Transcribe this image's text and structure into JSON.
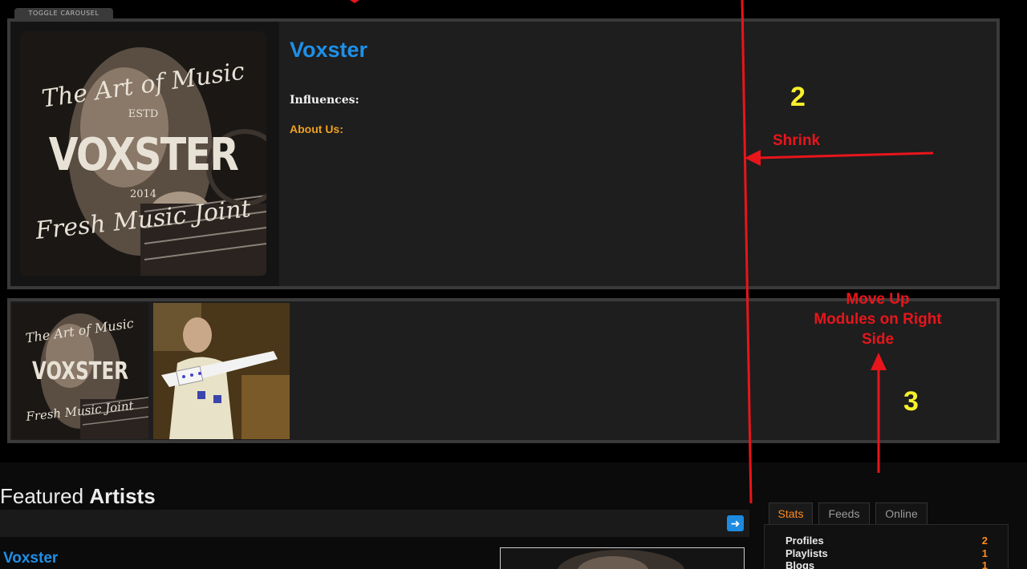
{
  "carousel": {
    "toggle_label": "TOGGLE CAROUSEL",
    "artist_name": "Voxster",
    "influences_label": "Influences:",
    "about_label": "About Us:",
    "artwork": {
      "line1": "The Art of Music",
      "estd": "ESTD",
      "brand": "VOXSTER",
      "year": "2014",
      "line2": "Fresh Music Joint"
    }
  },
  "featured": {
    "title_light": "Featured",
    "title_bold": "Artists",
    "artist_name": "Voxster"
  },
  "sidebar": {
    "tabs": [
      {
        "label": "Stats",
        "active": true
      },
      {
        "label": "Feeds",
        "active": false
      },
      {
        "label": "Online",
        "active": false
      }
    ],
    "stats": [
      {
        "label": "Profiles",
        "value": "2"
      },
      {
        "label": "Playlists",
        "value": "1"
      },
      {
        "label": "Blogs",
        "value": "1"
      }
    ]
  },
  "annotations": {
    "number_2": "2",
    "number_3": "3",
    "shrink": "Shrink",
    "move_up_line1": "Move Up",
    "move_up_line2": "Modules on Right",
    "move_up_line3": "Side"
  },
  "colors": {
    "link_blue": "#1e90e8",
    "accent_orange": "#f0a020",
    "annotation_red": "#e8151b",
    "annotation_yellow": "#f8f02a"
  }
}
